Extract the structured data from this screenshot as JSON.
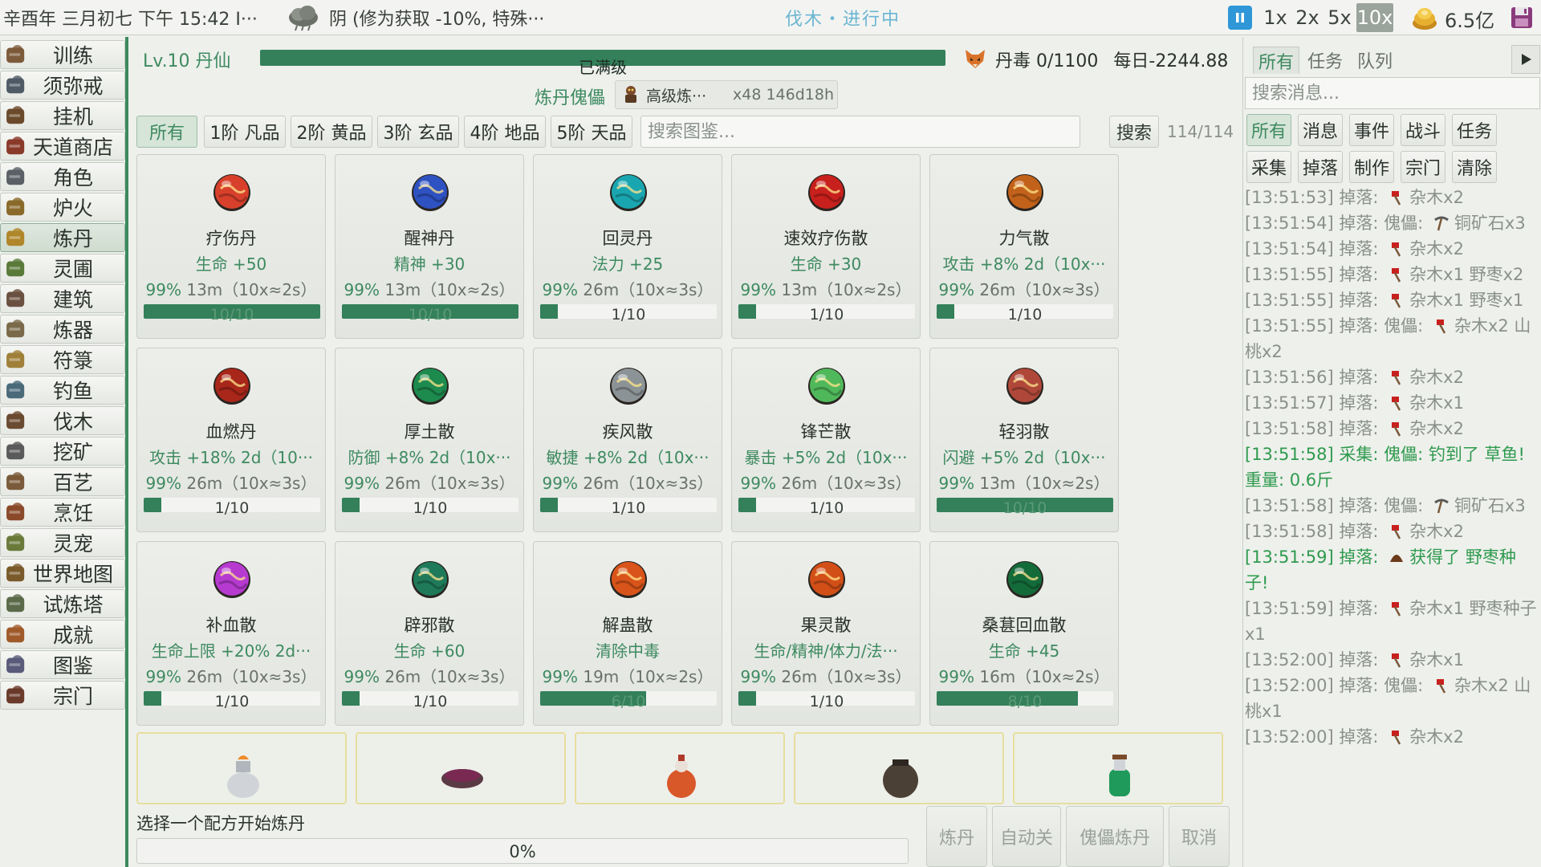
{
  "topbar": {
    "datetime": "辛酉年 三月初七 下午 15:42 I···",
    "weather_icon": "cloud-icon",
    "weather": "阴 (修为获取 -10%, 特殊···",
    "activity": "伐木・进行中",
    "speeds": [
      "1x",
      "2x",
      "5x",
      "10x"
    ],
    "active_speed": "10x",
    "money": "6.5亿"
  },
  "sidebar": {
    "items": [
      {
        "label": "训练",
        "icon": "training-icon"
      },
      {
        "label": "须弥戒",
        "icon": "ring-bag-icon"
      },
      {
        "label": "挂机",
        "icon": "idle-icon"
      },
      {
        "label": "天道商店",
        "icon": "shop-icon"
      },
      {
        "label": "角色",
        "icon": "character-icon"
      },
      {
        "label": "炉火",
        "icon": "furnace-icon"
      },
      {
        "label": "炼丹",
        "icon": "alchemy-icon"
      },
      {
        "label": "灵圃",
        "icon": "garden-icon"
      },
      {
        "label": "建筑",
        "icon": "building-icon"
      },
      {
        "label": "炼器",
        "icon": "forge-icon"
      },
      {
        "label": "符箓",
        "icon": "talisman-icon"
      },
      {
        "label": "钓鱼",
        "icon": "fishing-icon"
      },
      {
        "label": "伐木",
        "icon": "axe-icon"
      },
      {
        "label": "挖矿",
        "icon": "pickaxe-icon"
      },
      {
        "label": "百艺",
        "icon": "crafts-icon"
      },
      {
        "label": "烹饪",
        "icon": "cooking-icon"
      },
      {
        "label": "灵宠",
        "icon": "pet-icon"
      },
      {
        "label": "世界地图",
        "icon": "map-icon"
      },
      {
        "label": "试炼塔",
        "icon": "tower-icon"
      },
      {
        "label": "成就",
        "icon": "trophy-icon"
      },
      {
        "label": "图鉴",
        "icon": "book-icon"
      },
      {
        "label": "宗门",
        "icon": "sect-icon"
      }
    ]
  },
  "alchemy": {
    "level": "Lv.10 丹仙",
    "exp_text": "已满级",
    "exp_fraction": 1.0,
    "poison": "丹毒 0/1100",
    "daily": "每日-2244.88",
    "puppet_label": "炼丹傀儡",
    "puppet_name": "高级炼···",
    "puppet_count": "x48 146d18h",
    "tiers": [
      "所有",
      "1阶 凡品",
      "2阶 黄品",
      "3阶 玄品",
      "4阶 地品",
      "5阶 天品"
    ],
    "search_placeholder": "搜索图鉴...",
    "search_button": "搜索",
    "count": "114/114",
    "recipes": [
      {
        "name": "疗伤丹",
        "effect": "生命 +50",
        "rate": "99%",
        "time": "13m（10x≈2s）",
        "progress": "10/10",
        "fraction": 1.0,
        "icon": "red-pill-icon",
        "color": "#d8402b"
      },
      {
        "name": "醒神丹",
        "effect": "精神 +30",
        "rate": "99%",
        "time": "13m（10x≈2s）",
        "progress": "10/10",
        "fraction": 1.0,
        "icon": "blue-pill-icon",
        "color": "#2e52c2"
      },
      {
        "name": "回灵丹",
        "effect": "法力 +25",
        "rate": "99%",
        "time": "26m（10x≈3s）",
        "progress": "1/10",
        "fraction": 0.1,
        "icon": "cyan-pill-icon",
        "color": "#1aa6b0"
      },
      {
        "name": "速效疗伤散",
        "effect": "生命 +30",
        "rate": "99%",
        "time": "13m（10x≈2s）",
        "progress": "1/10",
        "fraction": 0.1,
        "icon": "crimson-pill-icon",
        "color": "#c8201d"
      },
      {
        "name": "力气散",
        "effect": "攻击 +8% 2d（10x···",
        "rate": "99%",
        "time": "26m（10x≈3s）",
        "progress": "1/10",
        "fraction": 0.1,
        "icon": "amber-pill-icon",
        "color": "#c2621a"
      },
      {
        "name": "血燃丹",
        "effect": "攻击 +18% 2d（10···",
        "rate": "99%",
        "time": "26m（10x≈3s）",
        "progress": "1/10",
        "fraction": 0.1,
        "icon": "flame-pill-icon",
        "color": "#a8261a"
      },
      {
        "name": "厚土散",
        "effect": "防御 +8% 2d（10x···",
        "rate": "99%",
        "time": "26m（10x≈3s）",
        "progress": "1/10",
        "fraction": 0.1,
        "icon": "green-pill-icon",
        "color": "#1d8a4e"
      },
      {
        "name": "疾风散",
        "effect": "敏捷 +8% 2d（10x···",
        "rate": "99%",
        "time": "26m（10x≈3s）",
        "progress": "1/10",
        "fraction": 0.1,
        "icon": "silver-pill-icon",
        "color": "#8c9396"
      },
      {
        "name": "锋芒散",
        "effect": "暴击 +5% 2d（10x···",
        "rate": "99%",
        "time": "26m（10x≈3s）",
        "progress": "1/10",
        "fraction": 0.1,
        "icon": "leaf-pill-icon",
        "color": "#4fb85a"
      },
      {
        "name": "轻羽散",
        "effect": "闪避 +5% 2d（10x···",
        "rate": "99%",
        "time": "13m（10x≈2s）",
        "progress": "10/10",
        "fraction": 1.0,
        "icon": "packet-icon",
        "color": "#b0483a"
      },
      {
        "name": "补血散",
        "effect": "生命上限 +20% 2d···",
        "rate": "99%",
        "time": "26m（10x≈3s）",
        "progress": "1/10",
        "fraction": 0.1,
        "icon": "bowl-icon",
        "color": "#b63ad0"
      },
      {
        "name": "辟邪散",
        "effect": "生命 +60",
        "rate": "99%",
        "time": "26m（10x≈3s）",
        "progress": "1/10",
        "fraction": 0.1,
        "icon": "jade-dish-icon",
        "color": "#1f7a5a"
      },
      {
        "name": "解蛊散",
        "effect": "清除中毒",
        "rate": "99%",
        "time": "19m（10x≈2s）",
        "progress": "6/10",
        "fraction": 0.6,
        "icon": "orange-pill-icon",
        "color": "#d9541a"
      },
      {
        "name": "果灵散",
        "effect": "生命/精神/体力/法···",
        "rate": "99%",
        "time": "26m（10x≈3s）",
        "progress": "1/10",
        "fraction": 0.1,
        "icon": "fruit-pill-icon",
        "color": "#d24f18"
      },
      {
        "name": "桑葚回血散",
        "effect": "生命 +45",
        "rate": "99%",
        "time": "16m（10x≈2s）",
        "progress": "8/10",
        "fraction": 0.8,
        "icon": "mulberry-pill-icon",
        "color": "#146b3a"
      }
    ],
    "furnaces": [
      {
        "icon": "white-urn-icon",
        "color": "#d0d4d8"
      },
      {
        "icon": "purple-bowl-icon",
        "color": "#7a2a52"
      },
      {
        "icon": "gourd-icon",
        "color": "#d8582a"
      },
      {
        "icon": "clay-jar-icon",
        "color": "#4b4036"
      },
      {
        "icon": "green-bottle-icon",
        "color": "#1f9a5a"
      }
    ],
    "hint": "选择一个配方开始炼丹",
    "progress_text": "0%",
    "progress_fraction": 0,
    "buttons": {
      "start": "炼丹",
      "auto": "自动关",
      "puppet": "傀儡炼丹",
      "cancel": "取消"
    }
  },
  "log": {
    "tabs": [
      "所有",
      "任务",
      "队列"
    ],
    "search_placeholder": "搜索消息...",
    "filters": [
      "所有",
      "消息",
      "事件",
      "战斗",
      "任务",
      "采集",
      "掉落",
      "制作",
      "宗门",
      "清除"
    ],
    "entries": [
      {
        "text_before": "[13:51:53] 掉落: ",
        "icon": "red-axe-icon",
        "text_after": "杂木x2",
        "highlight": false
      },
      {
        "text_before": "[13:51:54] 掉落: 傀儡: ",
        "icon": "pickaxe-icon",
        "text_after": "铜矿石x3",
        "highlight": false
      },
      {
        "text_before": "[13:51:54] 掉落: ",
        "icon": "red-axe-icon",
        "text_after": "杂木x2",
        "highlight": false
      },
      {
        "text_before": "[13:51:55] 掉落: ",
        "icon": "red-axe-icon",
        "text_after": "杂木x1 野枣x2",
        "highlight": false
      },
      {
        "text_before": "[13:51:55] 掉落: ",
        "icon": "red-axe-icon",
        "text_after": "杂木x1 野枣x1",
        "highlight": false
      },
      {
        "text_before": "[13:51:55] 掉落: 傀儡: ",
        "icon": "red-axe-icon",
        "text_after": "杂木x2 山桃x2",
        "highlight": false
      },
      {
        "text_before": "[13:51:56] 掉落: ",
        "icon": "red-axe-icon",
        "text_after": "杂木x2",
        "highlight": false
      },
      {
        "text_before": "[13:51:57] 掉落: ",
        "icon": "red-axe-icon",
        "text_after": "杂木x1",
        "highlight": false
      },
      {
        "text_before": "[13:51:58] 掉落: ",
        "icon": "red-axe-icon",
        "text_after": "杂木x2",
        "highlight": false
      },
      {
        "text_before": "[13:51:58] 采集: 傀儡: 钓到了 草鱼! 重量: 0.6斤",
        "icon": "",
        "text_after": "",
        "highlight": true
      },
      {
        "text_before": "[13:51:58] 掉落: 傀儡: ",
        "icon": "pickaxe-icon",
        "text_after": "铜矿石x3",
        "highlight": false
      },
      {
        "text_before": "[13:51:58] 掉落: ",
        "icon": "red-axe-icon",
        "text_after": "杂木x2",
        "highlight": false
      },
      {
        "text_before": "[13:51:59] 掉落: ",
        "icon": "seed-icon",
        "text_after": "获得了 野枣种子!",
        "highlight": true
      },
      {
        "text_before": "[13:51:59] 掉落: ",
        "icon": "red-axe-icon",
        "text_after": "杂木x1 野枣种子x1",
        "highlight": false
      },
      {
        "text_before": "[13:52:00] 掉落: ",
        "icon": "red-axe-icon",
        "text_after": "杂木x1",
        "highlight": false
      },
      {
        "text_before": "[13:52:00] 掉落: 傀儡: ",
        "icon": "red-axe-icon",
        "text_after": "杂木x2 山桃x1",
        "highlight": false
      },
      {
        "text_before": "[13:52:00] 掉落: ",
        "icon": "red-axe-icon",
        "text_after": "杂木x2",
        "highlight": false
      }
    ]
  },
  "colors": {
    "accent": "#33805a",
    "accent_text": "#3e8a60",
    "highlight_log": "#2f9a4e",
    "pause": "#2f97d8",
    "activity": "#6bb5d3"
  }
}
